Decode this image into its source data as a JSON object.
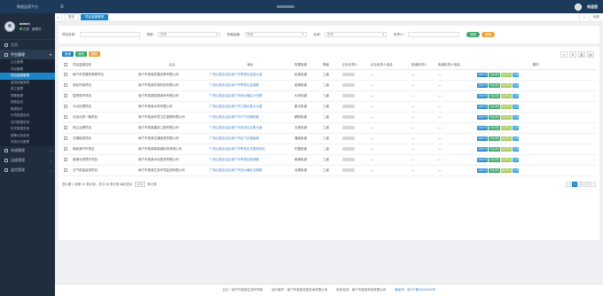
{
  "app": {
    "title": "数据监管平台"
  },
  "top": {
    "menu_icon": "hamburger-icon",
    "user_label": "欢迎您"
  },
  "user": {
    "name": "admin",
    "status_online": "在线",
    "status_role": "管理员"
  },
  "sidebar": {
    "home": "主页",
    "platform_group": "平台管理",
    "sub_items": [
      "企业管理",
      "项目管理",
      "项目监管管理",
      "监测设备管理",
      "施工管理",
      "预警管理",
      "视频监控",
      "数据统计",
      "环境数据查询",
      "实时数据查询",
      "历史数据查询",
      "报警记录查询",
      "系统日志管理"
    ],
    "active_index": 2,
    "groups": [
      "系统管理",
      "运维管理",
      "监控管理"
    ]
  },
  "tabs": {
    "home": "首页",
    "active": "项目监管管理",
    "refresh": "刷新",
    "close": "关闭"
  },
  "filters": {
    "name_label": "项目名称：",
    "name_placeholder": "",
    "type_label": "类型：",
    "type_value": "所有",
    "status_label": "所属监管：",
    "status_value": "所有",
    "area_label": "区域：",
    "area_value": "所有",
    "owner_label": "负责人：",
    "search": "搜索",
    "reset": "重置"
  },
  "toolbar": {
    "add": "新增",
    "edit": "修改",
    "delete": "删除"
  },
  "table": {
    "headers": [
      "",
      "项目监管名称",
      "企业",
      "地址",
      "所属街道",
      "等级",
      "企业负责人",
      "企业负责人电话",
      "街道负责人",
      "街道负责人电话",
      "操作"
    ],
    "rows": [
      {
        "name": "南宁市发展改革委项目",
        "company": "南宁市某某发展改革有限公司",
        "address": "广西壮族自治区南宁市青秀区民族大道",
        "street": "民族街道",
        "level": "三级"
      },
      {
        "name": "绿色环保项目",
        "company": "南宁市某某环保科技有限公司",
        "address": "广西壮族自治区南宁市青秀区金湖路",
        "street": "金湖街道",
        "level": "二级"
      },
      {
        "name": "智慧城市项目",
        "company": "南宁市某某智慧城市有限公司",
        "address": "广西壮族自治区南宁市西乡塘区大学路",
        "street": "大学街道",
        "level": "三级"
      },
      {
        "name": "污水处理项目",
        "company": "南宁市某某水务有限公司",
        "address": "广西壮族自治区南宁市江南区星光大道",
        "street": "星光街道",
        "level": "三级"
      },
      {
        "name": "垃圾分类一期项目",
        "company": "南宁市某某环境卫生管理有限公司",
        "address": "广西壮族自治区南宁市兴宁区朝阳路",
        "street": "朝阳街道",
        "level": "二级"
      },
      {
        "name": "扬尘治理项目",
        "company": "南宁市某某建设工程有限公司",
        "address": "广西壮族自治区南宁市良庆区五象大道",
        "street": "五象街道",
        "level": "三级"
      },
      {
        "name": "交通枢纽项目",
        "company": "南宁市某某交通投资有限公司",
        "address": "广西壮族自治区南宁市邕宁区蒲庙镇",
        "street": "蒲庙街道",
        "level": "三级"
      },
      {
        "name": "新能源汽车项目",
        "company": "南宁市某某新能源科技有限公司",
        "address": "广西壮族自治区南宁市青秀区东盟商务区",
        "street": "东盟街道",
        "level": "二级"
      },
      {
        "name": "南湖水质提升项目",
        "company": "南宁市某某水利投资有限公司",
        "address": "广西壮族自治区南宁市青秀区南湖路",
        "street": "南湖街道",
        "level": "三级"
      },
      {
        "name": "空气质量监测项目",
        "company": "南宁市某某生态环境监测有限公司",
        "address": "广西壮族自治区南宁市西乡塘区北湖路",
        "street": "北湖街道",
        "level": "三级"
      }
    ],
    "actions": [
      "巡检排查",
      "查看详情",
      "指定整改",
      "处理"
    ]
  },
  "pager": {
    "summary": "显示第 1 到第 10 条记录，总共 28 条记录 每页显示",
    "page_size": "10",
    "suffix": "条记录",
    "pages": [
      "‹",
      "1",
      "2",
      "3",
      "›"
    ]
  },
  "footer": {
    "sponsor": "主办：南宁市某某生态环境局",
    "operator": "运行维护：南宁市某某信息技术有限公司",
    "support": "技术支持：南宁市某某科技有限公司",
    "record": "备案号：桂ICP备00000000号"
  }
}
